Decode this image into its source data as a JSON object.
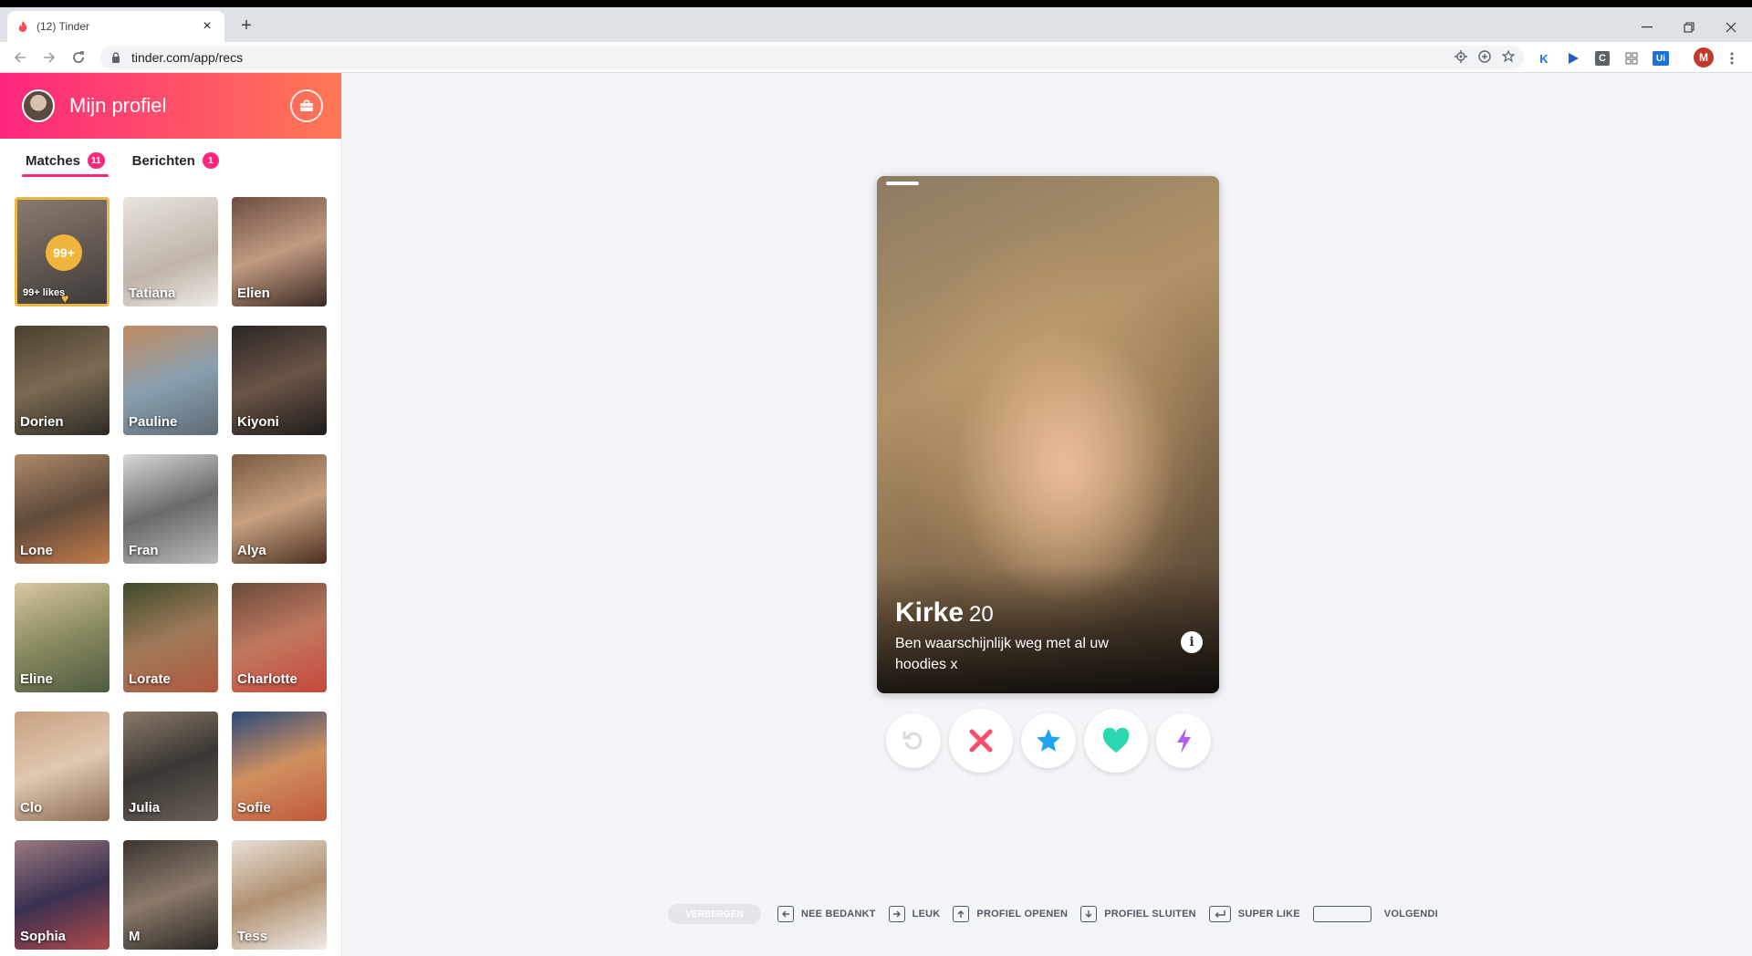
{
  "browser": {
    "tab_title": "(12) Tinder",
    "url": "tinder.com/app/recs",
    "ext_avatar_letter": "M"
  },
  "sidebar": {
    "profile_title": "Mijn profiel",
    "tabs": [
      {
        "label": "Matches",
        "badge": "11"
      },
      {
        "label": "Berichten",
        "badge": "1"
      }
    ],
    "likes": {
      "count": "99+",
      "label": "99+ likes"
    },
    "matches": [
      {
        "name": "Tatiana"
      },
      {
        "name": "Elien"
      },
      {
        "name": "Dorien"
      },
      {
        "name": "Pauline"
      },
      {
        "name": "Kiyoni"
      },
      {
        "name": "Lone"
      },
      {
        "name": "Fran"
      },
      {
        "name": "Alya"
      },
      {
        "name": "Eline"
      },
      {
        "name": "Lorate"
      },
      {
        "name": "Charlotte"
      },
      {
        "name": "Clo"
      },
      {
        "name": "Julia"
      },
      {
        "name": "Sofie"
      },
      {
        "name": "Sophia"
      },
      {
        "name": "M"
      },
      {
        "name": "Tess"
      }
    ]
  },
  "card": {
    "name": "Kirke",
    "age": "20",
    "bio": "Ben waarschijnlijk weg met al uw hoodies x"
  },
  "shortcuts": {
    "hide": "VERBERGEN",
    "nope": "NEE BEDANKT",
    "like": "LEUK",
    "open": "PROFIEL OPENEN",
    "close": "PROFIEL SLUITEN",
    "superlike": "SUPER LIKE",
    "next": "VOLGENDI"
  },
  "colors": {
    "brand_start": "#fd267d",
    "brand_end": "#ff7854",
    "nope": "#fd4d6c",
    "superlike": "#1ea4ee",
    "like": "#2ad9b0",
    "boost": "#b45cf5",
    "gold": "#f0b63b"
  }
}
